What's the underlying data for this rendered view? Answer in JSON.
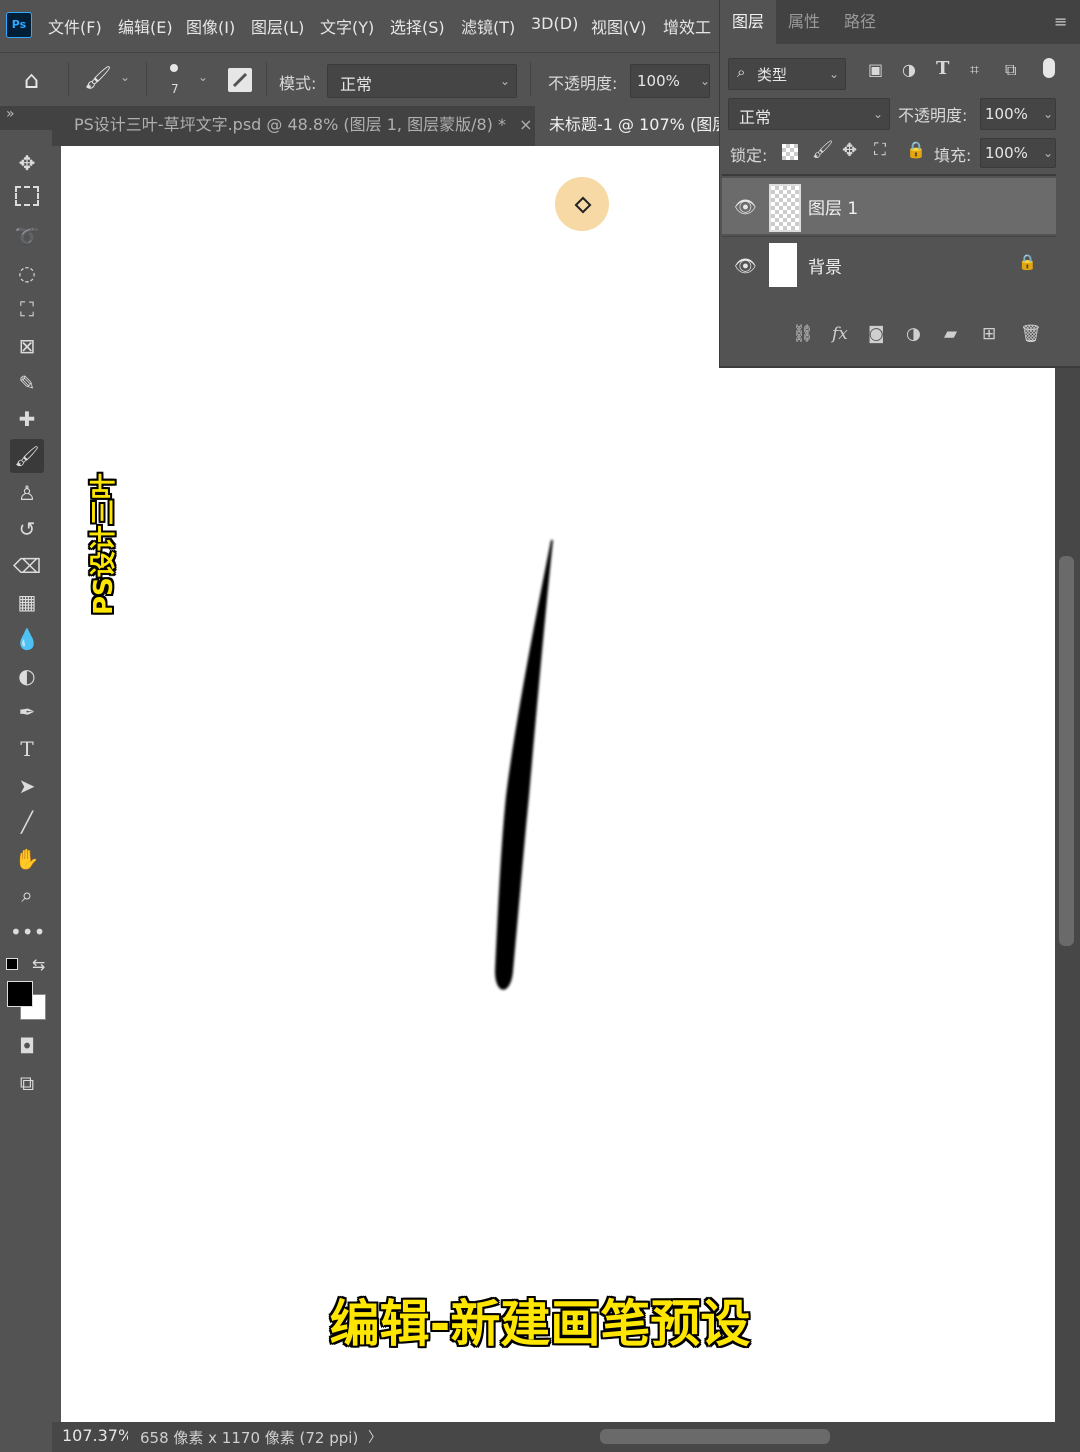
{
  "menu": {
    "logo": "Ps",
    "items": [
      "文件(F)",
      "编辑(E)",
      "图像(I)",
      "图层(L)",
      "文字(Y)",
      "选择(S)",
      "滤镜(T)",
      "3D(D)",
      "视图(V)",
      "增效工"
    ]
  },
  "options": {
    "brush_size": "7",
    "mode_label": "模式:",
    "mode_value": "正常",
    "opacity_label": "不透明度:",
    "opacity_value": "100%"
  },
  "tabs": [
    {
      "label": "PS设计三叶-草坪文字.psd @ 48.8% (图层 1, 图层蒙版/8) *",
      "close": "×"
    },
    {
      "label": "未标题-1 @ 107% (图层"
    }
  ],
  "watermark": "PS设计三叶",
  "subtitle": "编辑-新建画笔预设",
  "status": {
    "zoom": "107.37%",
    "doc_info": "658 像素 x 1170 像素 (72 ppi)",
    "arrow": "〉"
  },
  "layers_panel": {
    "tabs": [
      "图层",
      "属性",
      "路径"
    ],
    "filter_label": "类型",
    "blend_mode": "正常",
    "opacity_label": "不透明度:",
    "opacity_value": "100%",
    "lock_label": "锁定:",
    "fill_label": "填充:",
    "fill_value": "100%",
    "layers": [
      {
        "name": "图层 1",
        "selected": true
      },
      {
        "name": "背景",
        "locked": true
      }
    ]
  },
  "colors": {
    "foreground": "#000000",
    "background": "#ffffff",
    "accent": "#ffe600"
  }
}
